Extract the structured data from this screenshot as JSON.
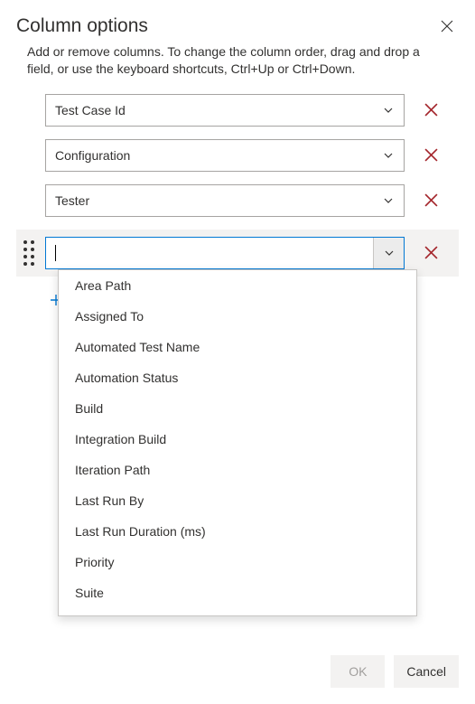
{
  "header": {
    "title": "Column options"
  },
  "description": "Add or remove columns. To change the column order, drag and drop a field, or use the keyboard shortcuts, Ctrl+Up or Ctrl+Down.",
  "columns": [
    {
      "value": "Test Case Id"
    },
    {
      "value": "Configuration"
    },
    {
      "value": "Tester"
    }
  ],
  "active_combo_value": "",
  "dropdown": {
    "options": [
      "Area Path",
      "Assigned To",
      "Automated Test Name",
      "Automation Status",
      "Build",
      "Integration Build",
      "Iteration Path",
      "Last Run By",
      "Last Run Duration (ms)",
      "Priority",
      "Suite"
    ]
  },
  "buttons": {
    "ok": "OK",
    "cancel": "Cancel"
  },
  "colors": {
    "accent": "#0078d4",
    "danger": "#a4262c"
  }
}
